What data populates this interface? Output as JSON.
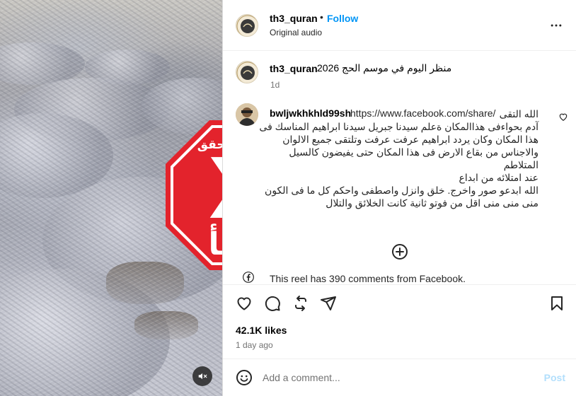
{
  "post": {
    "username": "th3_quran",
    "separator": "•",
    "follow_label": "Follow",
    "audio_label": "Original audio"
  },
  "caption": {
    "username": "th3_quran",
    "text": "منظر اليوم في موسم الحج 2026",
    "time": "1d"
  },
  "comment": {
    "username": "bwljwkhkhld99sh",
    "link": "https://www.facebook.com/share/",
    "lines": [
      "الله التقى",
      "آدم بحواءفى هذاالمكان ةعلم سيدنا جبريل سيدنا ابراهيم المناسك فى",
      "هذا المكان وكان يردد ابراهيم عرفت عرفت وتلتقى جميع الالوان",
      "والاجناس من بقاع الارض فى هذا المكان حتى يفيضون كالسيل",
      "المتلاطم",
      "عند امتلائه من ابداع",
      "الله ابدعو صور واخرج. خلق وانزل واصطفى واحكم كل ما فى الكون",
      "منى منى منى اقل من فوتو ثانية كانت الخلائق والتلال"
    ]
  },
  "stamp": {
    "hashtag": "#النهار_تتحقق",
    "mark": "X",
    "verdict": "خطأ",
    "color": "#e3232c"
  },
  "facebook_note": "This reel has 390 comments from Facebook.",
  "stats": {
    "likes": "42.1K likes",
    "ago": "1 day ago"
  },
  "composer": {
    "placeholder": "Add a comment...",
    "post_label": "Post"
  },
  "colors": {
    "link_blue": "#0095f6",
    "post_disabled": "#b2dffc",
    "muted": "#737373"
  }
}
